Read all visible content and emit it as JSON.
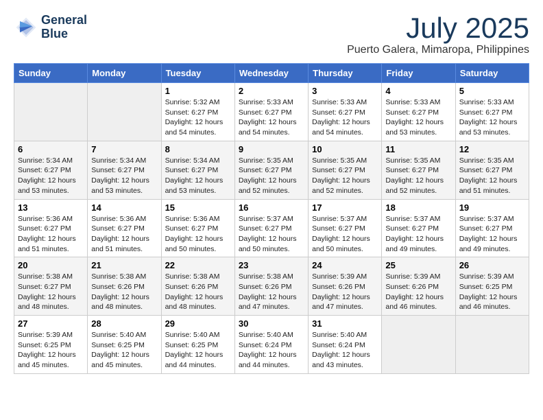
{
  "header": {
    "logo_line1": "General",
    "logo_line2": "Blue",
    "month": "July 2025",
    "location": "Puerto Galera, Mimaropa, Philippines"
  },
  "weekdays": [
    "Sunday",
    "Monday",
    "Tuesday",
    "Wednesday",
    "Thursday",
    "Friday",
    "Saturday"
  ],
  "weeks": [
    [
      {
        "day": "",
        "sunrise": "",
        "sunset": "",
        "daylight": "",
        "empty": true
      },
      {
        "day": "",
        "sunrise": "",
        "sunset": "",
        "daylight": "",
        "empty": true
      },
      {
        "day": "1",
        "sunrise": "Sunrise: 5:32 AM",
        "sunset": "Sunset: 6:27 PM",
        "daylight": "Daylight: 12 hours and 54 minutes.",
        "empty": false
      },
      {
        "day": "2",
        "sunrise": "Sunrise: 5:33 AM",
        "sunset": "Sunset: 6:27 PM",
        "daylight": "Daylight: 12 hours and 54 minutes.",
        "empty": false
      },
      {
        "day": "3",
        "sunrise": "Sunrise: 5:33 AM",
        "sunset": "Sunset: 6:27 PM",
        "daylight": "Daylight: 12 hours and 54 minutes.",
        "empty": false
      },
      {
        "day": "4",
        "sunrise": "Sunrise: 5:33 AM",
        "sunset": "Sunset: 6:27 PM",
        "daylight": "Daylight: 12 hours and 53 minutes.",
        "empty": false
      },
      {
        "day": "5",
        "sunrise": "Sunrise: 5:33 AM",
        "sunset": "Sunset: 6:27 PM",
        "daylight": "Daylight: 12 hours and 53 minutes.",
        "empty": false
      }
    ],
    [
      {
        "day": "6",
        "sunrise": "Sunrise: 5:34 AM",
        "sunset": "Sunset: 6:27 PM",
        "daylight": "Daylight: 12 hours and 53 minutes.",
        "empty": false
      },
      {
        "day": "7",
        "sunrise": "Sunrise: 5:34 AM",
        "sunset": "Sunset: 6:27 PM",
        "daylight": "Daylight: 12 hours and 53 minutes.",
        "empty": false
      },
      {
        "day": "8",
        "sunrise": "Sunrise: 5:34 AM",
        "sunset": "Sunset: 6:27 PM",
        "daylight": "Daylight: 12 hours and 53 minutes.",
        "empty": false
      },
      {
        "day": "9",
        "sunrise": "Sunrise: 5:35 AM",
        "sunset": "Sunset: 6:27 PM",
        "daylight": "Daylight: 12 hours and 52 minutes.",
        "empty": false
      },
      {
        "day": "10",
        "sunrise": "Sunrise: 5:35 AM",
        "sunset": "Sunset: 6:27 PM",
        "daylight": "Daylight: 12 hours and 52 minutes.",
        "empty": false
      },
      {
        "day": "11",
        "sunrise": "Sunrise: 5:35 AM",
        "sunset": "Sunset: 6:27 PM",
        "daylight": "Daylight: 12 hours and 52 minutes.",
        "empty": false
      },
      {
        "day": "12",
        "sunrise": "Sunrise: 5:35 AM",
        "sunset": "Sunset: 6:27 PM",
        "daylight": "Daylight: 12 hours and 51 minutes.",
        "empty": false
      }
    ],
    [
      {
        "day": "13",
        "sunrise": "Sunrise: 5:36 AM",
        "sunset": "Sunset: 6:27 PM",
        "daylight": "Daylight: 12 hours and 51 minutes.",
        "empty": false
      },
      {
        "day": "14",
        "sunrise": "Sunrise: 5:36 AM",
        "sunset": "Sunset: 6:27 PM",
        "daylight": "Daylight: 12 hours and 51 minutes.",
        "empty": false
      },
      {
        "day": "15",
        "sunrise": "Sunrise: 5:36 AM",
        "sunset": "Sunset: 6:27 PM",
        "daylight": "Daylight: 12 hours and 50 minutes.",
        "empty": false
      },
      {
        "day": "16",
        "sunrise": "Sunrise: 5:37 AM",
        "sunset": "Sunset: 6:27 PM",
        "daylight": "Daylight: 12 hours and 50 minutes.",
        "empty": false
      },
      {
        "day": "17",
        "sunrise": "Sunrise: 5:37 AM",
        "sunset": "Sunset: 6:27 PM",
        "daylight": "Daylight: 12 hours and 50 minutes.",
        "empty": false
      },
      {
        "day": "18",
        "sunrise": "Sunrise: 5:37 AM",
        "sunset": "Sunset: 6:27 PM",
        "daylight": "Daylight: 12 hours and 49 minutes.",
        "empty": false
      },
      {
        "day": "19",
        "sunrise": "Sunrise: 5:37 AM",
        "sunset": "Sunset: 6:27 PM",
        "daylight": "Daylight: 12 hours and 49 minutes.",
        "empty": false
      }
    ],
    [
      {
        "day": "20",
        "sunrise": "Sunrise: 5:38 AM",
        "sunset": "Sunset: 6:27 PM",
        "daylight": "Daylight: 12 hours and 48 minutes.",
        "empty": false
      },
      {
        "day": "21",
        "sunrise": "Sunrise: 5:38 AM",
        "sunset": "Sunset: 6:26 PM",
        "daylight": "Daylight: 12 hours and 48 minutes.",
        "empty": false
      },
      {
        "day": "22",
        "sunrise": "Sunrise: 5:38 AM",
        "sunset": "Sunset: 6:26 PM",
        "daylight": "Daylight: 12 hours and 48 minutes.",
        "empty": false
      },
      {
        "day": "23",
        "sunrise": "Sunrise: 5:38 AM",
        "sunset": "Sunset: 6:26 PM",
        "daylight": "Daylight: 12 hours and 47 minutes.",
        "empty": false
      },
      {
        "day": "24",
        "sunrise": "Sunrise: 5:39 AM",
        "sunset": "Sunset: 6:26 PM",
        "daylight": "Daylight: 12 hours and 47 minutes.",
        "empty": false
      },
      {
        "day": "25",
        "sunrise": "Sunrise: 5:39 AM",
        "sunset": "Sunset: 6:26 PM",
        "daylight": "Daylight: 12 hours and 46 minutes.",
        "empty": false
      },
      {
        "day": "26",
        "sunrise": "Sunrise: 5:39 AM",
        "sunset": "Sunset: 6:25 PM",
        "daylight": "Daylight: 12 hours and 46 minutes.",
        "empty": false
      }
    ],
    [
      {
        "day": "27",
        "sunrise": "Sunrise: 5:39 AM",
        "sunset": "Sunset: 6:25 PM",
        "daylight": "Daylight: 12 hours and 45 minutes.",
        "empty": false
      },
      {
        "day": "28",
        "sunrise": "Sunrise: 5:40 AM",
        "sunset": "Sunset: 6:25 PM",
        "daylight": "Daylight: 12 hours and 45 minutes.",
        "empty": false
      },
      {
        "day": "29",
        "sunrise": "Sunrise: 5:40 AM",
        "sunset": "Sunset: 6:25 PM",
        "daylight": "Daylight: 12 hours and 44 minutes.",
        "empty": false
      },
      {
        "day": "30",
        "sunrise": "Sunrise: 5:40 AM",
        "sunset": "Sunset: 6:24 PM",
        "daylight": "Daylight: 12 hours and 44 minutes.",
        "empty": false
      },
      {
        "day": "31",
        "sunrise": "Sunrise: 5:40 AM",
        "sunset": "Sunset: 6:24 PM",
        "daylight": "Daylight: 12 hours and 43 minutes.",
        "empty": false
      },
      {
        "day": "",
        "sunrise": "",
        "sunset": "",
        "daylight": "",
        "empty": true
      },
      {
        "day": "",
        "sunrise": "",
        "sunset": "",
        "daylight": "",
        "empty": true
      }
    ]
  ]
}
